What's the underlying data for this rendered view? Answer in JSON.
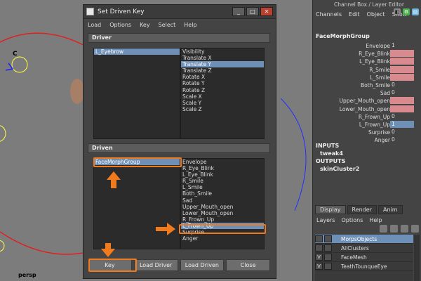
{
  "viewport": {
    "camera_label": "persp",
    "handle_label": "C"
  },
  "window": {
    "title": "Set Driven Key",
    "controls": [
      "_",
      "□",
      "✕"
    ],
    "menus": [
      "Load",
      "Options",
      "Key",
      "Select",
      "Help"
    ],
    "driver": {
      "header": "Driver",
      "objects": [
        "L_Eyebrow"
      ],
      "selected_object": 0,
      "attributes": [
        "Visibility",
        "Translate X",
        "Translate Y",
        "Translate Z",
        "Rotate X",
        "Rotate Y",
        "Rotate Z",
        "Scale X",
        "Scale Y",
        "Scale Z"
      ],
      "selected_attribute": 2
    },
    "driven": {
      "header": "Driven",
      "objects": [
        "FaceMorphGroup"
      ],
      "selected_object": 0,
      "attributes": [
        "Envelope",
        "R_Eye_Blink",
        "L_Eye_Blink",
        "R_Smile",
        "L_Smile",
        "Both_Smile",
        "Sad",
        "Upper_Mouth_open",
        "Lower_Mouth_open",
        "R_Frown_Up",
        "L_Frown_Up",
        "Surprise",
        "Anger"
      ],
      "selected_attribute": 10
    },
    "buttons": [
      "Key",
      "Load Driver",
      "Load Driven",
      "Close"
    ]
  },
  "channel_box": {
    "title": "Channel Box / Layer Editor",
    "menus": [
      "Channels",
      "Edit",
      "Object",
      "Show"
    ],
    "node": "FaceMorphGroup",
    "attributes": [
      {
        "label": "Envelope",
        "value": "1",
        "style": "plain"
      },
      {
        "label": "R_Eye_Blink",
        "value": "",
        "style": "pink"
      },
      {
        "label": "L_Eye_Blink",
        "value": "",
        "style": "pink"
      },
      {
        "label": "R_Smile",
        "value": "",
        "style": "pink"
      },
      {
        "label": "L_Smile",
        "value": "",
        "style": "pink"
      },
      {
        "label": "Both_Smile",
        "value": "0",
        "style": "plain"
      },
      {
        "label": "Sad",
        "value": "0",
        "style": "plain"
      },
      {
        "label": "Upper_Mouth_open",
        "value": "",
        "style": "pink"
      },
      {
        "label": "Lower_Mouth_open",
        "value": "",
        "style": "pink"
      },
      {
        "label": "R_Frown_Up",
        "value": "0",
        "style": "plain"
      },
      {
        "label": "L_Frown_Up",
        "value": "1",
        "style": "selv"
      },
      {
        "label": "Surprise",
        "value": "0",
        "style": "plain"
      },
      {
        "label": "Anger",
        "value": "0",
        "style": "plain"
      }
    ],
    "inputs_label": "INPUTS",
    "input_node": "tweak4",
    "outputs_label": "OUTPUTS",
    "output_node": "skinCluster2"
  },
  "layer_editor": {
    "tabs": [
      "Display",
      "Render",
      "Anim"
    ],
    "active_tab": 0,
    "menus": [
      "Layers",
      "Options",
      "Help"
    ],
    "layers": [
      {
        "name": "MorpsObjects",
        "v": "",
        "selected": true
      },
      {
        "name": "AllClusters",
        "v": "",
        "selected": false
      },
      {
        "name": "FaceMesh",
        "v": "V",
        "selected": false
      },
      {
        "name": "TeathTounqueEye",
        "v": "V",
        "selected": false
      }
    ]
  },
  "colors": {
    "highlight": "#f07a1c",
    "selection": "#6e90b6",
    "keyed": "#d98a8f"
  }
}
